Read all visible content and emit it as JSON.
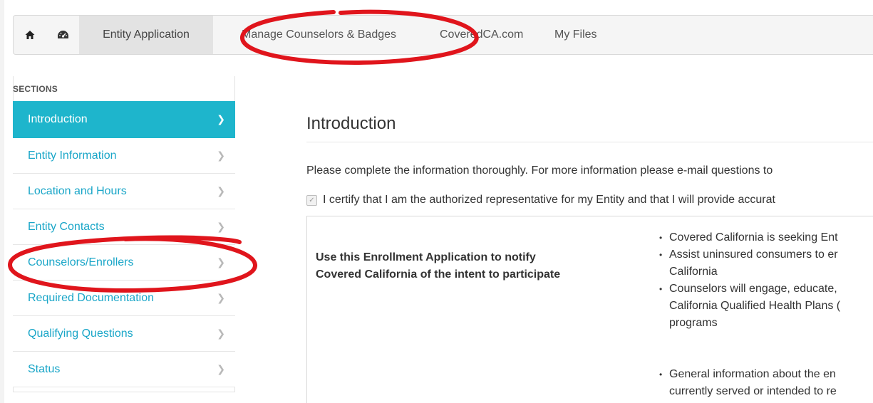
{
  "nav": {
    "items": [
      {
        "label": "Entity Application"
      },
      {
        "label": "Manage Counselors & Badges"
      },
      {
        "label": "CoveredCA.com"
      },
      {
        "label": "My Files"
      }
    ]
  },
  "sidebar": {
    "heading": "SECTIONS",
    "items": [
      {
        "label": "Introduction"
      },
      {
        "label": "Entity Information"
      },
      {
        "label": "Location and Hours"
      },
      {
        "label": "Entity Contacts"
      },
      {
        "label": "Counselors/Enrollers"
      },
      {
        "label": "Required Documentation"
      },
      {
        "label": "Qualifying Questions"
      },
      {
        "label": "Status"
      }
    ]
  },
  "main": {
    "title": "Introduction",
    "intro": "Please complete the information thoroughly. For more information please e-mail questions to",
    "certify": "I certify that I am the authorized representative for my Entity and that I will provide accurat",
    "box_heading_line1": "Use this Enrollment Application to notify",
    "box_heading_line2": "Covered California of the intent to participate",
    "bullets": [
      {
        "lines": [
          "Covered California is seeking Ent"
        ]
      },
      {
        "lines": [
          "Assist uninsured consumers to er",
          "California"
        ]
      },
      {
        "lines": [
          "Counselors will engage, educate,",
          "California Qualified Health Plans (",
          "programs"
        ]
      },
      {
        "lines": [
          "General information about the en",
          "currently served or intended to re"
        ]
      }
    ]
  },
  "colors": {
    "accent": "#1eb5cc",
    "link": "#1aa6c8",
    "annotation": "#e0151c"
  },
  "icons": {
    "home": "home-icon",
    "dashboard": "dashboard-icon",
    "chevron": "chevron-right-icon",
    "check": "checkbox-check-icon"
  }
}
